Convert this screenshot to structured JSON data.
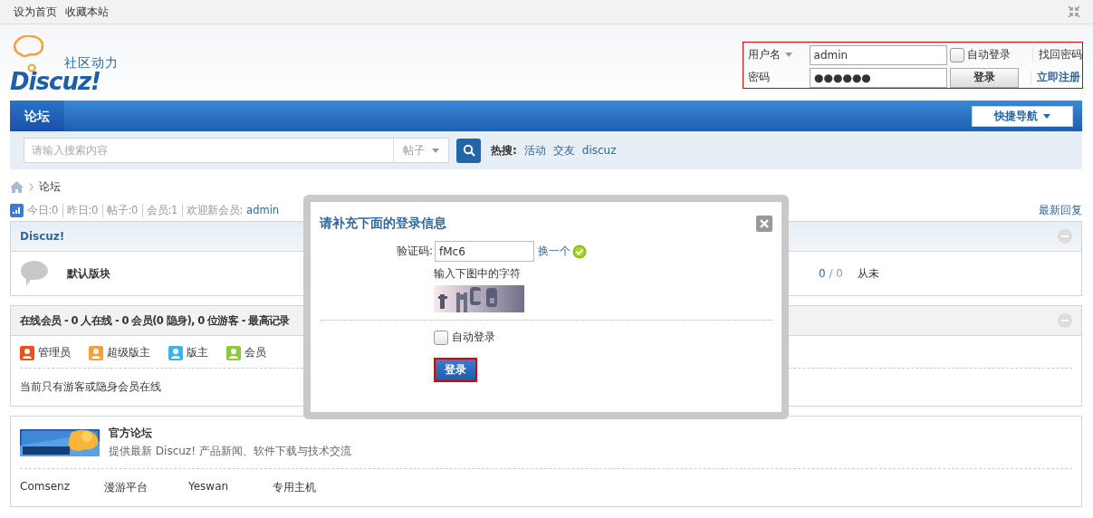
{
  "top_links": [
    "设为首页",
    "收藏本站"
  ],
  "logo": {
    "tagline": "社区动力",
    "name": "Discuz!"
  },
  "login": {
    "username_label": "用户名",
    "username": "admin",
    "password_label": "密码",
    "password": "●●●●●●",
    "auto_login": {
      "label": "自动登录",
      "checked": false
    },
    "button": "登录",
    "links": [
      "找回密码",
      "立即注册"
    ]
  },
  "nav": {
    "tabs": [
      {
        "label": "论坛",
        "selected": true
      }
    ],
    "quick_nav": "快捷导航"
  },
  "search": {
    "placeholder": "请输入搜索内容",
    "scope": "帖子",
    "hot_label": "热搜:",
    "hot": [
      "活动",
      "交友",
      "discuz"
    ]
  },
  "breadcrumb": [
    "论坛"
  ],
  "stats": [
    {
      "label": "今日:",
      "value": "0"
    },
    {
      "label": "昨日:",
      "value": "0"
    },
    {
      "label": "帖子:",
      "value": "0"
    },
    {
      "label": "会员:",
      "value": "1"
    }
  ],
  "new_member": {
    "label": "欢迎新会员:",
    "name": "admin"
  },
  "latest_reply": "最新回复",
  "category": {
    "title": "Discuz!",
    "forums": [
      {
        "name": "默认版块",
        "threads": "0",
        "posts": "/ 0",
        "last_post": "从未"
      }
    ]
  },
  "online": {
    "title": "在线会员 - 0 人在线 - 0 会员(0 隐身), 0 位游客 - 最高记录",
    "legend": [
      {
        "label": "管理员",
        "color": "#e8541c"
      },
      {
        "label": "超级版主",
        "color": "#f2a23a"
      },
      {
        "label": "版主",
        "color": "#3db4e8"
      },
      {
        "label": "会员",
        "color": "#8dc63f"
      }
    ],
    "note": "当前只有游客或隐身会员在线"
  },
  "links": {
    "site": {
      "title": "官方论坛",
      "desc": "提供最新 Discuz! 产品新闻、软件下载与技术交流"
    },
    "items": [
      "Comsenz",
      "漫游平台",
      "Yeswan",
      "专用主机"
    ]
  },
  "dialog": {
    "title": "请补充下面的登录信息",
    "captcha_label": "验证码:",
    "captcha_value": "fMc6",
    "refresh": "换一个",
    "valid": true,
    "hint": "输入下图中的字符",
    "auto_login": {
      "label": "自动登录",
      "checked": false
    },
    "submit": "登录"
  }
}
